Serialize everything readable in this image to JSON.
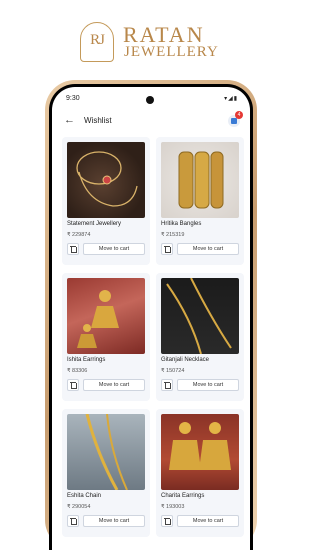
{
  "brand": {
    "monogram": "RJ",
    "line1": "RATAN",
    "line2": "JEWELLERY"
  },
  "status": {
    "time": "9:30"
  },
  "appbar": {
    "title": "Wishlist",
    "cart_badge": "4"
  },
  "products": [
    {
      "name": "Statement Jewellery",
      "price": "₹ 229874",
      "action": "Move to cart"
    },
    {
      "name": "Hritika Bangles",
      "price": "₹ 215319",
      "action": "Move to cart"
    },
    {
      "name": "Ishita Earrings",
      "price": "₹ 83306",
      "action": "Move to cart"
    },
    {
      "name": "Gitanjali Necklace",
      "price": "₹ 150724",
      "action": "Move to cart"
    },
    {
      "name": "Eshita Chain",
      "price": "₹ 290054",
      "action": "Move to cart"
    },
    {
      "name": "Charita Earrings",
      "price": "₹ 193003",
      "action": "Move to cart"
    }
  ],
  "colors": {
    "gold": "#b8874a",
    "accent": "#3a7bd5",
    "badge": "#e53935"
  }
}
